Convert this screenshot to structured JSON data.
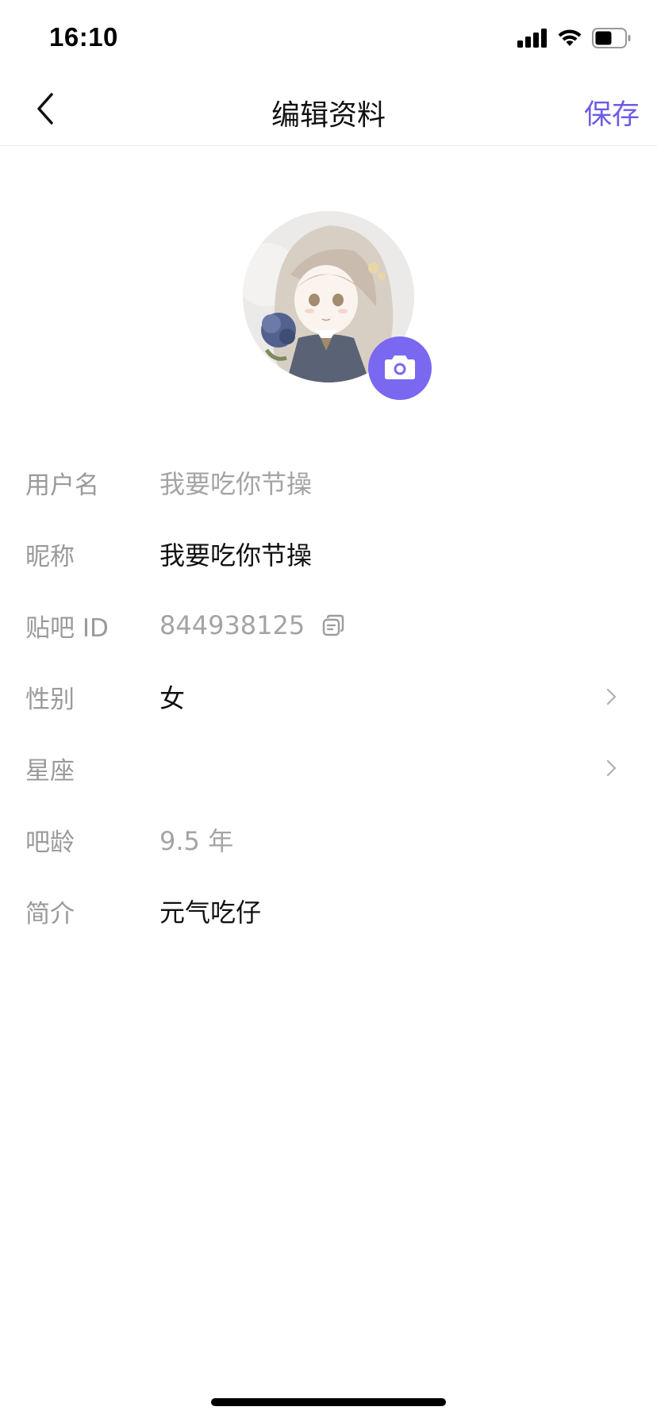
{
  "status_bar": {
    "time": "16:10"
  },
  "nav": {
    "title": "编辑资料",
    "save_label": "保存"
  },
  "theme": {
    "accent": "#6b5ce7",
    "camera_bg": "#7a68f0"
  },
  "profile": {
    "fields": [
      {
        "label": "用户名",
        "value": "我要吃你节操"
      },
      {
        "label": "昵称",
        "value": "我要吃你节操"
      },
      {
        "label": "贴吧 ID",
        "value": "844938125"
      },
      {
        "label": "性别",
        "value": "女"
      },
      {
        "label": "星座",
        "value": ""
      },
      {
        "label": "吧龄",
        "value": "9.5 年"
      },
      {
        "label": "简介",
        "value": "元气吃仔"
      }
    ]
  }
}
